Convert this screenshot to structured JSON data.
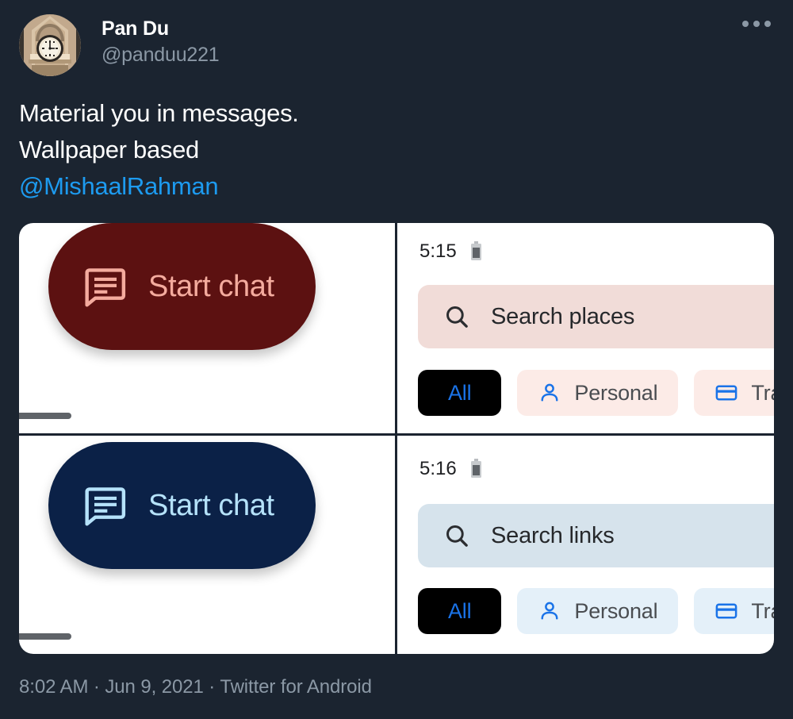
{
  "tweet": {
    "author": {
      "display_name": "Pan Du",
      "handle": "@panduu221",
      "avatar_icon": "clock-tower-avatar"
    },
    "more_icon": "more-horizontal-icon",
    "text_lines": [
      "Material you in messages.",
      "Wallpaper based"
    ],
    "mention": "@MishaalRahman",
    "footer": {
      "time": "8:02 AM",
      "sep1": " · ",
      "date": "Jun 9, 2021",
      "sep2": " · ",
      "source": "Twitter for Android"
    }
  },
  "media": {
    "panes": [
      {
        "id": "fab-red",
        "fab_label": "Start chat",
        "fab_icon": "message-chat-icon",
        "fab_bg": "#5c1111",
        "fab_fg": "#f4ab9e",
        "nav_handle_icon": "nav-bar-handle"
      },
      {
        "id": "phone-pink",
        "clock": "5:15",
        "battery_icon": "battery-icon",
        "search_placeholder": "Search places",
        "search_icon": "search-icon",
        "search_bg": "#f1dcd8",
        "chips": [
          {
            "label": "All",
            "icon": null,
            "selected": true
          },
          {
            "label": "Personal",
            "icon": "person-icon",
            "selected": false
          },
          {
            "label": "Transacti",
            "icon": "credit-card-icon",
            "selected": false
          }
        ],
        "chip_accent": "#1a73e8"
      },
      {
        "id": "fab-blue",
        "fab_label": "Start chat",
        "fab_icon": "message-chat-icon",
        "fab_bg": "#0b2147",
        "fab_fg": "#b5e2fa",
        "nav_handle_icon": "nav-bar-handle"
      },
      {
        "id": "phone-blue",
        "clock": "5:16",
        "battery_icon": "battery-icon",
        "search_placeholder": "Search links",
        "search_icon": "search-icon",
        "search_bg": "#d6e3ec",
        "chips": [
          {
            "label": "All",
            "icon": null,
            "selected": true
          },
          {
            "label": "Personal",
            "icon": "person-icon",
            "selected": false
          },
          {
            "label": "Transac",
            "icon": "credit-card-icon",
            "selected": false
          }
        ],
        "chip_accent": "#1a73e8"
      }
    ]
  },
  "colors": {
    "page_bg": "#1b2430",
    "text_primary": "#ffffff",
    "text_secondary": "#8b98a5",
    "link": "#1d9bf0",
    "accent_blue": "#1a73e8"
  }
}
